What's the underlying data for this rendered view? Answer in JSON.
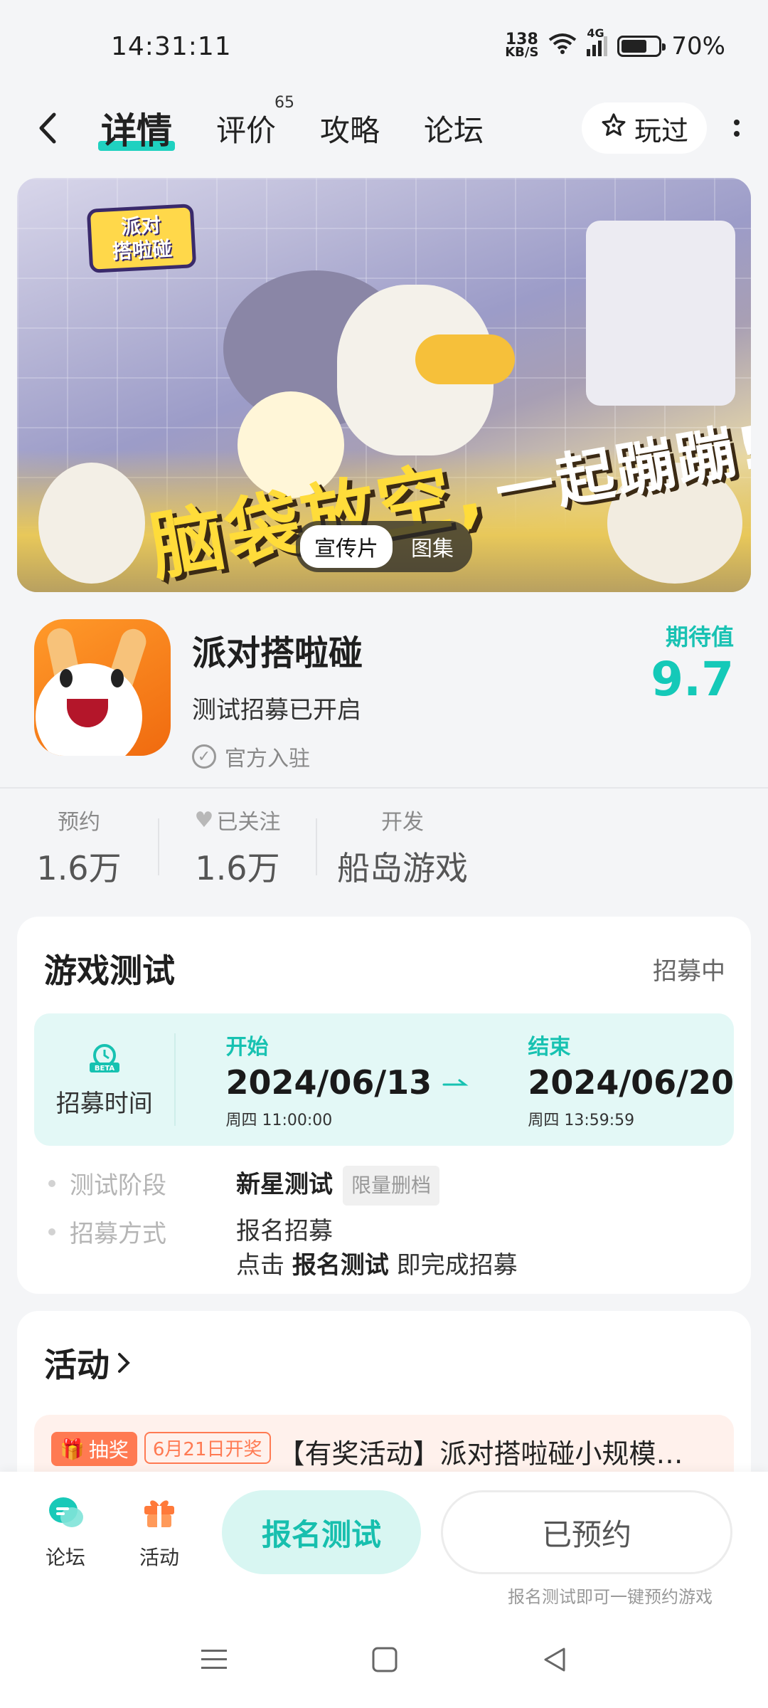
{
  "status_bar": {
    "time": "14:31:11",
    "net_speed_value": "138",
    "net_speed_unit": "KB/S",
    "network": "4G",
    "battery_percent": "70%",
    "battery_level": 0.7
  },
  "nav": {
    "tabs": [
      {
        "label": "详情",
        "active": true
      },
      {
        "label": "评价",
        "badge": "65"
      },
      {
        "label": "攻略"
      },
      {
        "label": "论坛"
      }
    ],
    "played_label": "玩过"
  },
  "banner": {
    "logo_line1": "派对",
    "logo_line2": "搭啦碰",
    "slogan_main": "脑袋放空,",
    "slogan_sub": "一起蹦蹦!",
    "switch": [
      "宣传片",
      "图集"
    ]
  },
  "game": {
    "title": "派对搭啦碰",
    "status": "测试招募已开启",
    "official": "官方入驻",
    "expect_label": "期待值",
    "expect_score": "9.7"
  },
  "stats": [
    {
      "label": "预约",
      "value": "1.6万"
    },
    {
      "label": "已关注",
      "value": "1.6万"
    },
    {
      "label": "开发",
      "value": "船岛游戏"
    }
  ],
  "test": {
    "title": "游戏测试",
    "status": "招募中",
    "time_label": "招募时间",
    "beta": "BETA",
    "start_tag": "开始",
    "start_date": "2024/06/13",
    "start_sub": "周四  11:00:00",
    "end_tag": "结束",
    "end_date": "2024/06/20",
    "end_sub": "周四  13:59:59",
    "phase_key": "测试阶段",
    "phase_val": "新星测试",
    "phase_tag": "限量删档",
    "method_key": "招募方式",
    "method_val": "报名招募",
    "method_desc_1": "点击",
    "method_desc_2": "报名测试",
    "method_desc_3": "即完成招募"
  },
  "activity": {
    "title": "活动",
    "tag": "抽奖",
    "date": "6月21日开奖",
    "text": "【有奖活动】派对搭啦碰小规模测试招募开启"
  },
  "bottom": {
    "forum": "论坛",
    "activity": "活动",
    "signup": "报名测试",
    "reserved": "已预约",
    "hint": "报名测试即可一键预约游戏"
  },
  "colors": {
    "accent": "#17c2b1",
    "orange": "#ff7a52"
  }
}
